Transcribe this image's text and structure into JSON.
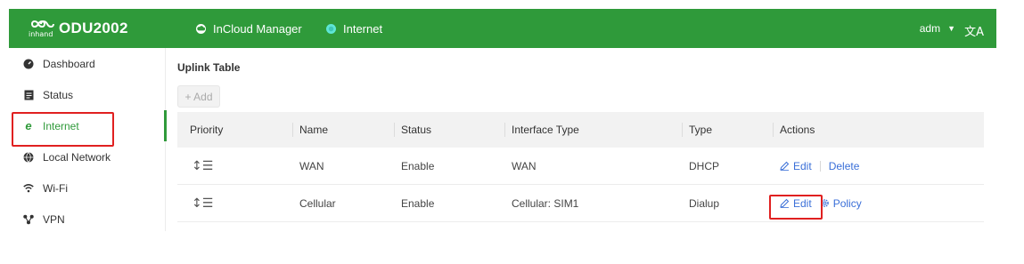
{
  "header": {
    "logo_sub": "inhand",
    "logo_text": "ODU2002",
    "apps": [
      {
        "label": "InCloud Manager",
        "icon": "cloud-icon"
      },
      {
        "label": "Internet",
        "icon": "status-dot-icon"
      }
    ],
    "user": "adm",
    "lang_icon": "translate-icon"
  },
  "sidebar": {
    "items": [
      {
        "label": "Dashboard",
        "icon": "dashboard-icon"
      },
      {
        "label": "Status",
        "icon": "status-doc-icon"
      },
      {
        "label": "Internet",
        "icon": "internet-e-icon",
        "active": true
      },
      {
        "label": "Local Network",
        "icon": "globe-icon"
      },
      {
        "label": "Wi-Fi",
        "icon": "wifi-icon"
      },
      {
        "label": "VPN",
        "icon": "vpn-icon"
      }
    ]
  },
  "main": {
    "title": "Uplink Table",
    "add_label": "+ Add",
    "columns": [
      "Priority",
      "Name",
      "Status",
      "Interface Type",
      "Type",
      "Actions"
    ],
    "rows": [
      {
        "name": "WAN",
        "status": "Enable",
        "interface_type": "WAN",
        "type": "DHCP",
        "actions": [
          "Edit",
          "Delete"
        ]
      },
      {
        "name": "Cellular",
        "status": "Enable",
        "interface_type": "Cellular: SIM1",
        "type": "Dialup",
        "actions": [
          "Edit",
          "Policy"
        ]
      }
    ]
  },
  "colors": {
    "brand": "#2f9a3a",
    "link": "#3a6fd8",
    "highlight": "#e02020"
  }
}
